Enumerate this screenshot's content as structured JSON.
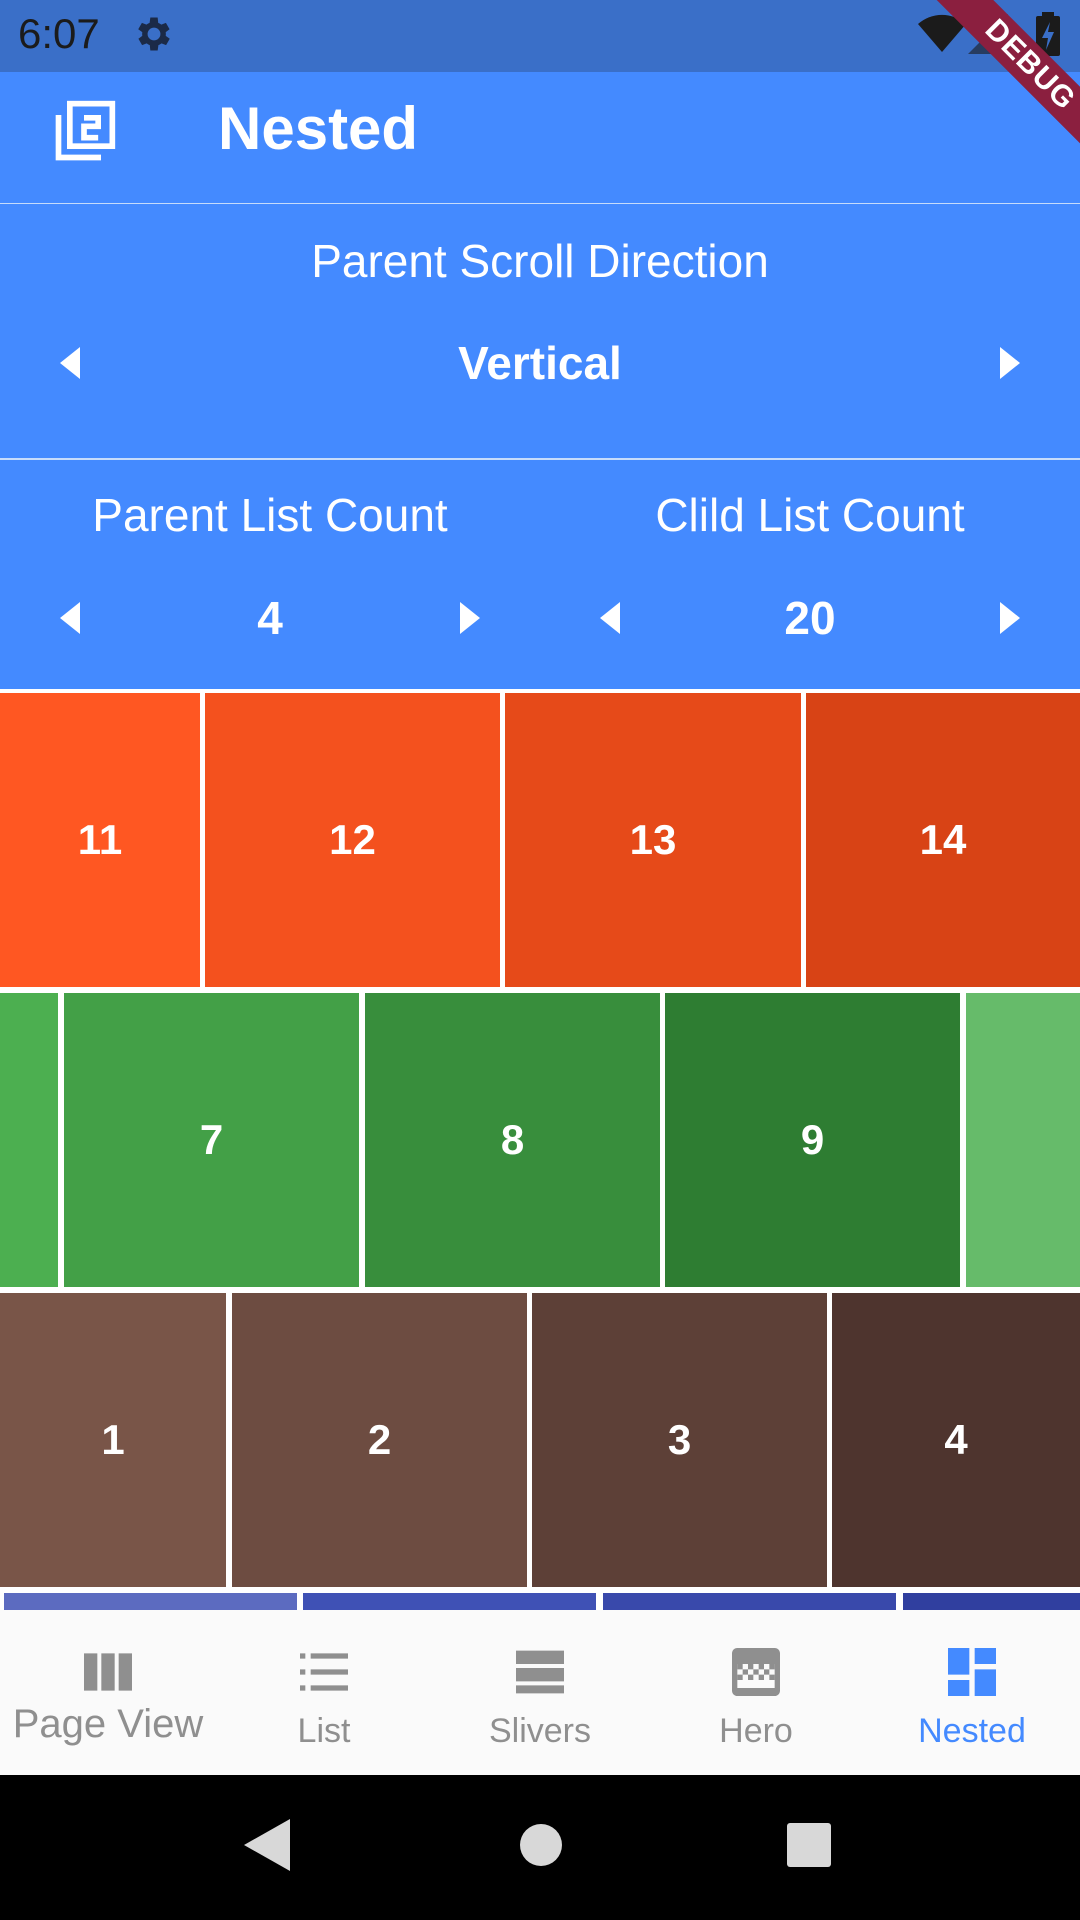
{
  "status_bar": {
    "time": "6:07",
    "settings_icon": "gear-icon",
    "wifi_icon": "wifi-icon",
    "signal_icon": "signal-icon",
    "battery_icon": "battery-icon"
  },
  "debug_banner": "DEBUG",
  "app_bar": {
    "title": "Nested",
    "logo_icon": "filter-2-icon"
  },
  "parent_scroll": {
    "label": "Parent Scroll Direction",
    "value": "Vertical"
  },
  "parent_count": {
    "label": "Parent List Count",
    "value": "4"
  },
  "child_count": {
    "label": "Clild List Count",
    "value": "20"
  },
  "rows": [
    {
      "tiles": [
        {
          "label": "11",
          "color": "#ff5722"
        },
        {
          "label": "12",
          "color": "#f4511e"
        },
        {
          "label": "13",
          "color": "#e64a19"
        },
        {
          "label": "14",
          "color": "#d84315"
        }
      ]
    },
    {
      "tiles": [
        {
          "label": "",
          "color": "#4caf50"
        },
        {
          "label": "7",
          "color": "#43a047"
        },
        {
          "label": "8",
          "color": "#388e3c"
        },
        {
          "label": "9",
          "color": "#2e7d32"
        },
        {
          "label": "",
          "color": "#66bb6a"
        }
      ]
    },
    {
      "tiles": [
        {
          "label": "1",
          "color": "#795548"
        },
        {
          "label": "2",
          "color": "#6d4c41"
        },
        {
          "label": "3",
          "color": "#5d4037"
        },
        {
          "label": "4",
          "color": "#4e342e"
        }
      ]
    },
    {
      "tiles": [
        {
          "label": "",
          "color": "#5c6bc0"
        },
        {
          "label": "",
          "color": "#3f51b5"
        },
        {
          "label": "",
          "color": "#3949ab"
        },
        {
          "label": "",
          "color": "#303f9f"
        }
      ]
    }
  ],
  "bottom_nav": {
    "active_color": "#448aff",
    "inactive_color": "#8f8f8f",
    "items": [
      {
        "label": "Page View",
        "icon": "view-column-icon"
      },
      {
        "label": "List",
        "icon": "list-icon"
      },
      {
        "label": "Slivers",
        "icon": "view-stream-icon"
      },
      {
        "label": "Hero",
        "icon": "gradient-icon"
      },
      {
        "label": "Nested",
        "icon": "dashboard-icon",
        "active": true
      }
    ]
  },
  "system_nav": {
    "back": "back-icon",
    "home": "home-icon",
    "recents": "recents-icon"
  }
}
